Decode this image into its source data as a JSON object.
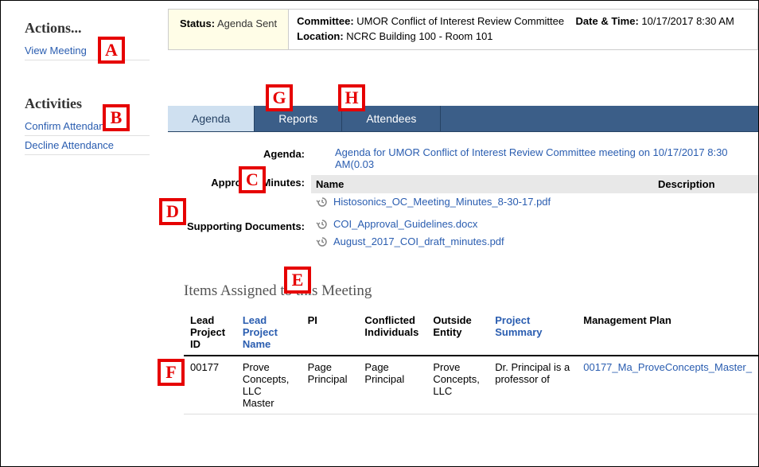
{
  "sidebar": {
    "actions_heading": "Actions...",
    "view_meeting": "View Meeting",
    "activities_heading": "Activities",
    "confirm_attendance": "Confirm Attendance",
    "decline_attendance": "Decline Attendance"
  },
  "status_bar": {
    "status_label": "Status:",
    "status_value": "Agenda Sent",
    "committee_label": "Committee:",
    "committee_value": "UMOR Conflict of Interest Review Committee",
    "datetime_label": "Date & Time:",
    "datetime_value": "10/17/2017 8:30 AM",
    "location_label": "Location:",
    "location_value": "NCRC Building 100 - Room 101"
  },
  "tabs": {
    "agenda": "Agenda",
    "reports": "Reports",
    "attendees": "Attendees"
  },
  "agenda_section": {
    "agenda_label": "Agenda:",
    "agenda_link": "Agenda for UMOR Conflict of Interest Review Committee meeting on 10/17/2017 8:30 AM(0.03",
    "approved_minutes_label": "Approved Minutes:",
    "supporting_docs_label": "Supporting Documents:",
    "doc_col_name": "Name",
    "doc_col_desc": "Description",
    "docs": [
      "Histosonics_OC_Meeting_Minutes_8-30-17.pdf",
      "COI_Approval_Guidelines.docx",
      "August_2017_COI_draft_minutes.pdf"
    ]
  },
  "items": {
    "heading": "Items Assigned to this Meeting",
    "headers": {
      "lead_id": "Lead Project ID",
      "lead_name": "Lead Project Name",
      "pi": "PI",
      "conflicted": "Conflicted Individuals",
      "outside": "Outside Entity",
      "summary": "Project Summary",
      "plan": "Management Plan"
    },
    "rows": [
      {
        "lead_id": "00177",
        "lead_name": "Prove Concepts, LLC Master",
        "pi": "Page Principal",
        "conflicted": "Page Principal",
        "outside": "Prove Concepts, LLC",
        "summary": "Dr. Principal is a professor of",
        "plan": "00177_Ma_ProveConcepts_Master_"
      }
    ]
  },
  "callouts": {
    "A": "A",
    "B": "B",
    "C": "C",
    "D": "D",
    "E": "E",
    "F": "F",
    "G": "G",
    "H": "H"
  }
}
